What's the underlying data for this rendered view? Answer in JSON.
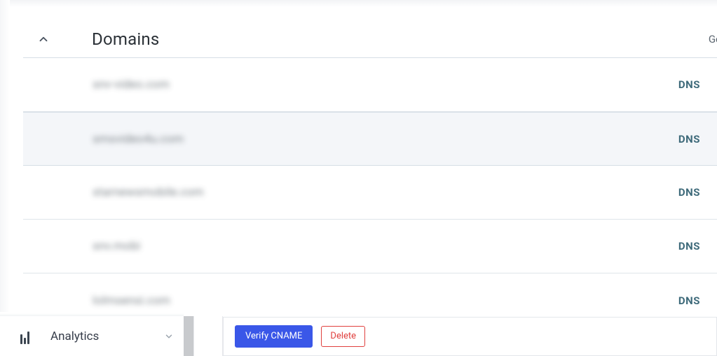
{
  "section": {
    "title": "Domains",
    "header_right": "Ge"
  },
  "rows": [
    {
      "domain": "snv-video.com",
      "badge": "DNS",
      "highlight": false
    },
    {
      "domain": "smsvideo4u.com",
      "badge": "DNS",
      "highlight": true
    },
    {
      "domain": "starnewsmobile.com",
      "badge": "DNS",
      "highlight": false
    },
    {
      "domain": "snv.mobi",
      "badge": "DNS",
      "highlight": false
    },
    {
      "domain": "lolmsensi.com",
      "badge": "DNS",
      "highlight": false
    }
  ],
  "sidebar": {
    "label": "Analytics"
  },
  "actions": {
    "verify": "Verify CNAME",
    "delete": "Delete"
  }
}
